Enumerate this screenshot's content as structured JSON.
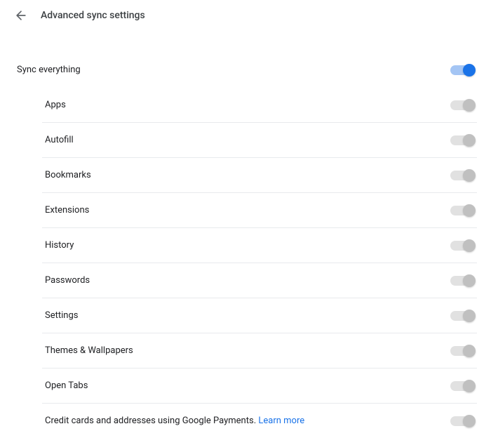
{
  "header": {
    "title": "Advanced sync settings"
  },
  "master": {
    "label": "Sync everything",
    "on": true
  },
  "items": [
    {
      "label": "Apps",
      "on": true,
      "disabled": true
    },
    {
      "label": "Autofill",
      "on": true,
      "disabled": true
    },
    {
      "label": "Bookmarks",
      "on": true,
      "disabled": true
    },
    {
      "label": "Extensions",
      "on": true,
      "disabled": true
    },
    {
      "label": "History",
      "on": true,
      "disabled": true
    },
    {
      "label": "Passwords",
      "on": true,
      "disabled": true
    },
    {
      "label": "Settings",
      "on": true,
      "disabled": true
    },
    {
      "label": "Themes & Wallpapers",
      "on": true,
      "disabled": true
    },
    {
      "label": "Open Tabs",
      "on": true,
      "disabled": true
    }
  ],
  "footer": {
    "text": "Credit cards and addresses using Google Payments. ",
    "link": "Learn more",
    "on": true,
    "disabled": true
  }
}
